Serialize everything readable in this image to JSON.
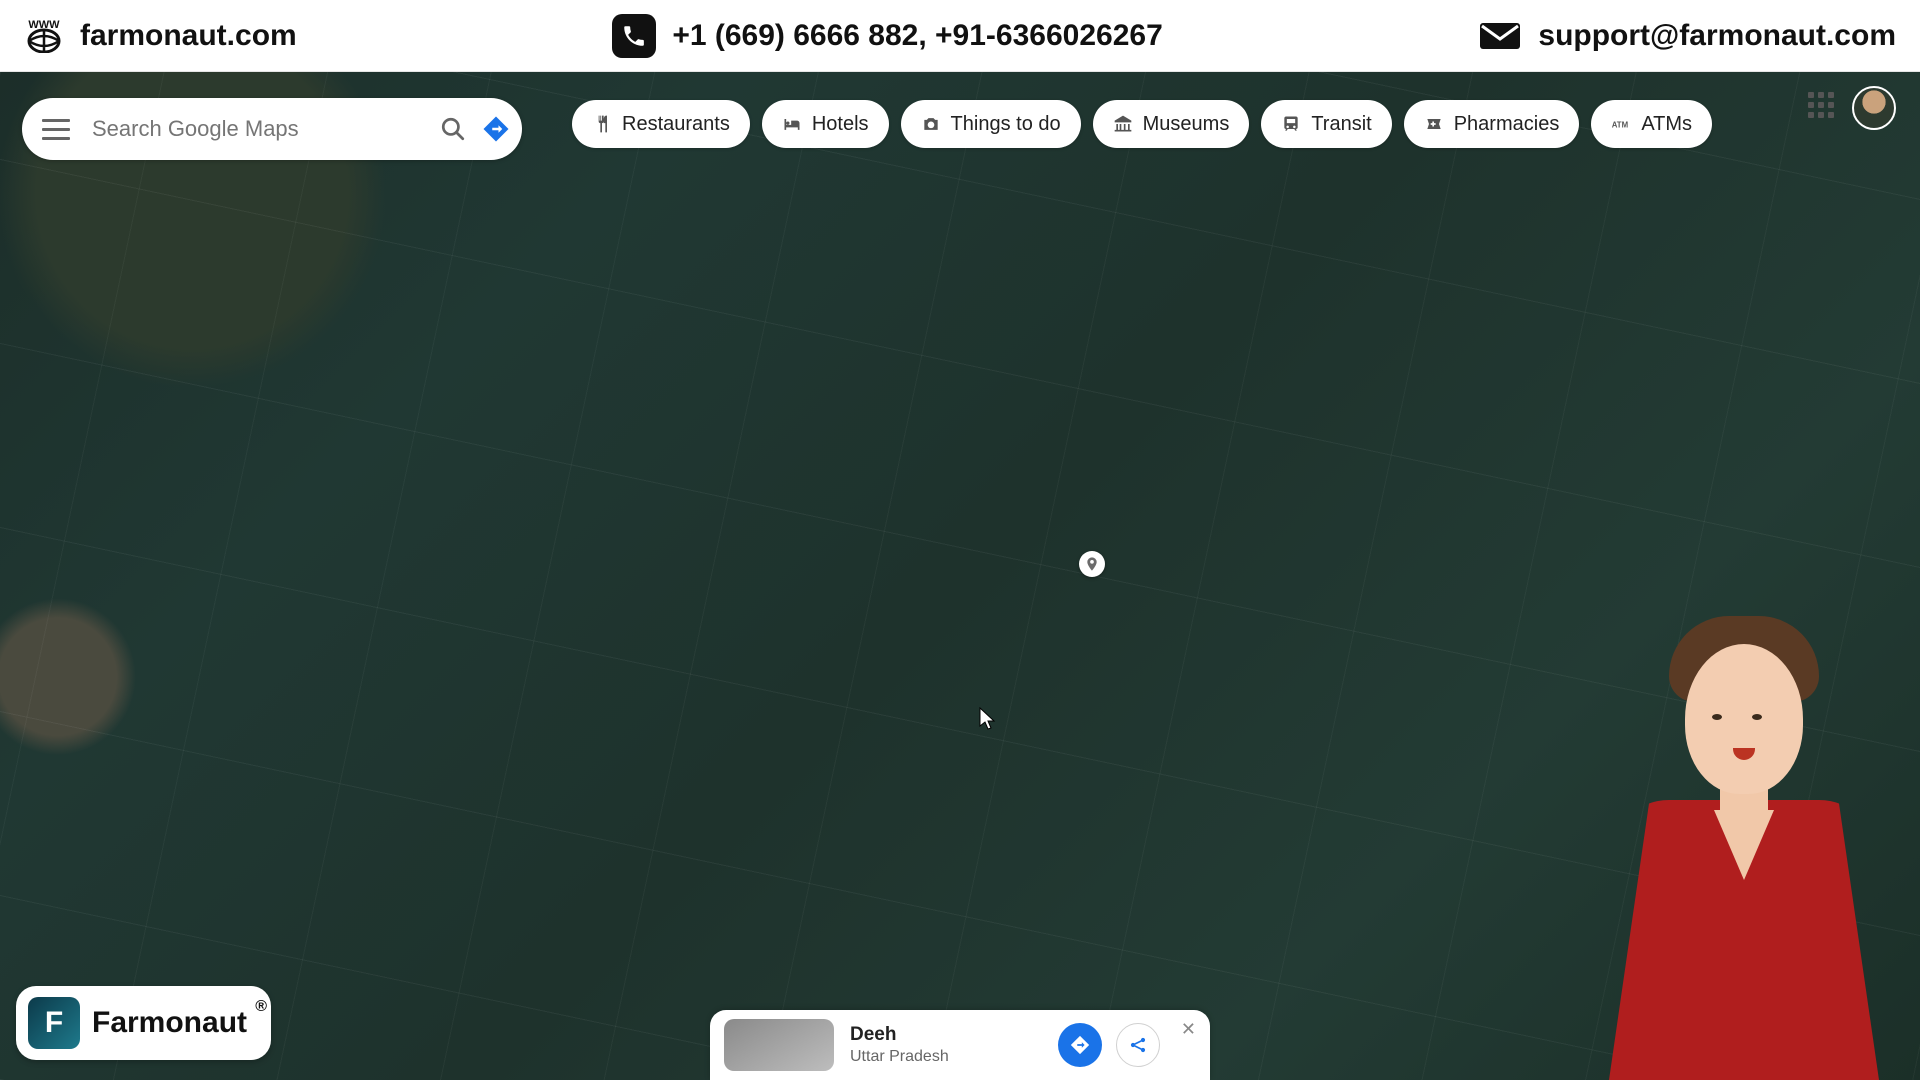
{
  "topbar": {
    "website": "farmonaut.com",
    "phone": "+1 (669) 6666 882, +91-6366026267",
    "email": "support@farmonaut.com"
  },
  "search": {
    "placeholder": "Search Google Maps"
  },
  "chips": [
    {
      "label": "Restaurants",
      "icon": "restaurant"
    },
    {
      "label": "Hotels",
      "icon": "hotel"
    },
    {
      "label": "Things to do",
      "icon": "camera"
    },
    {
      "label": "Museums",
      "icon": "museum"
    },
    {
      "label": "Transit",
      "icon": "transit"
    },
    {
      "label": "Pharmacies",
      "icon": "pharmacy"
    },
    {
      "label": "ATMs",
      "icon": "atm"
    }
  ],
  "badge": {
    "brand": "Farmonaut",
    "trademark": "®"
  },
  "place_card": {
    "title": "Deeh",
    "subtitle": "Uttar Pradesh"
  },
  "colors": {
    "accent_blue": "#1a73e8",
    "presenter_shirt": "#b01e1e"
  }
}
